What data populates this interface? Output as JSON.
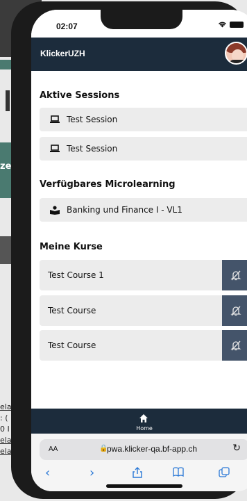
{
  "background": {
    "fragment_text": "ze",
    "links": [
      "ela",
      ": (",
      "0 I",
      "ela",
      "elau"
    ]
  },
  "status_bar": {
    "time": "02:07"
  },
  "app": {
    "title": "KlickerUZH"
  },
  "sections": {
    "active_sessions": {
      "title": "Aktive Sessions",
      "items": [
        {
          "label": "Test Session",
          "icon": "laptop-icon"
        },
        {
          "label": "Test Session",
          "icon": "laptop-icon"
        }
      ]
    },
    "microlearning": {
      "title": "Verfügbares Microlearning",
      "items": [
        {
          "label": "Banking und Finance I - VL1",
          "icon": "book-reader-icon"
        }
      ]
    },
    "courses": {
      "title": "Meine Kurse",
      "items": [
        {
          "label": "Test Course 1",
          "icon": "bell-off-icon"
        },
        {
          "label": "Test Course",
          "icon": "bell-off-icon"
        },
        {
          "label": "Test Course",
          "icon": "bell-off-icon"
        }
      ]
    }
  },
  "bottom_nav": {
    "home_label": "Home"
  },
  "browser": {
    "text_size_label": "AA",
    "url": "pwa.klicker-qa.bf-app.ch"
  },
  "colors": {
    "header_bg": "#1c2c3c",
    "bell_button_bg": "#44546a",
    "item_bg": "#ececec",
    "safari_accent": "#2a78d6"
  }
}
